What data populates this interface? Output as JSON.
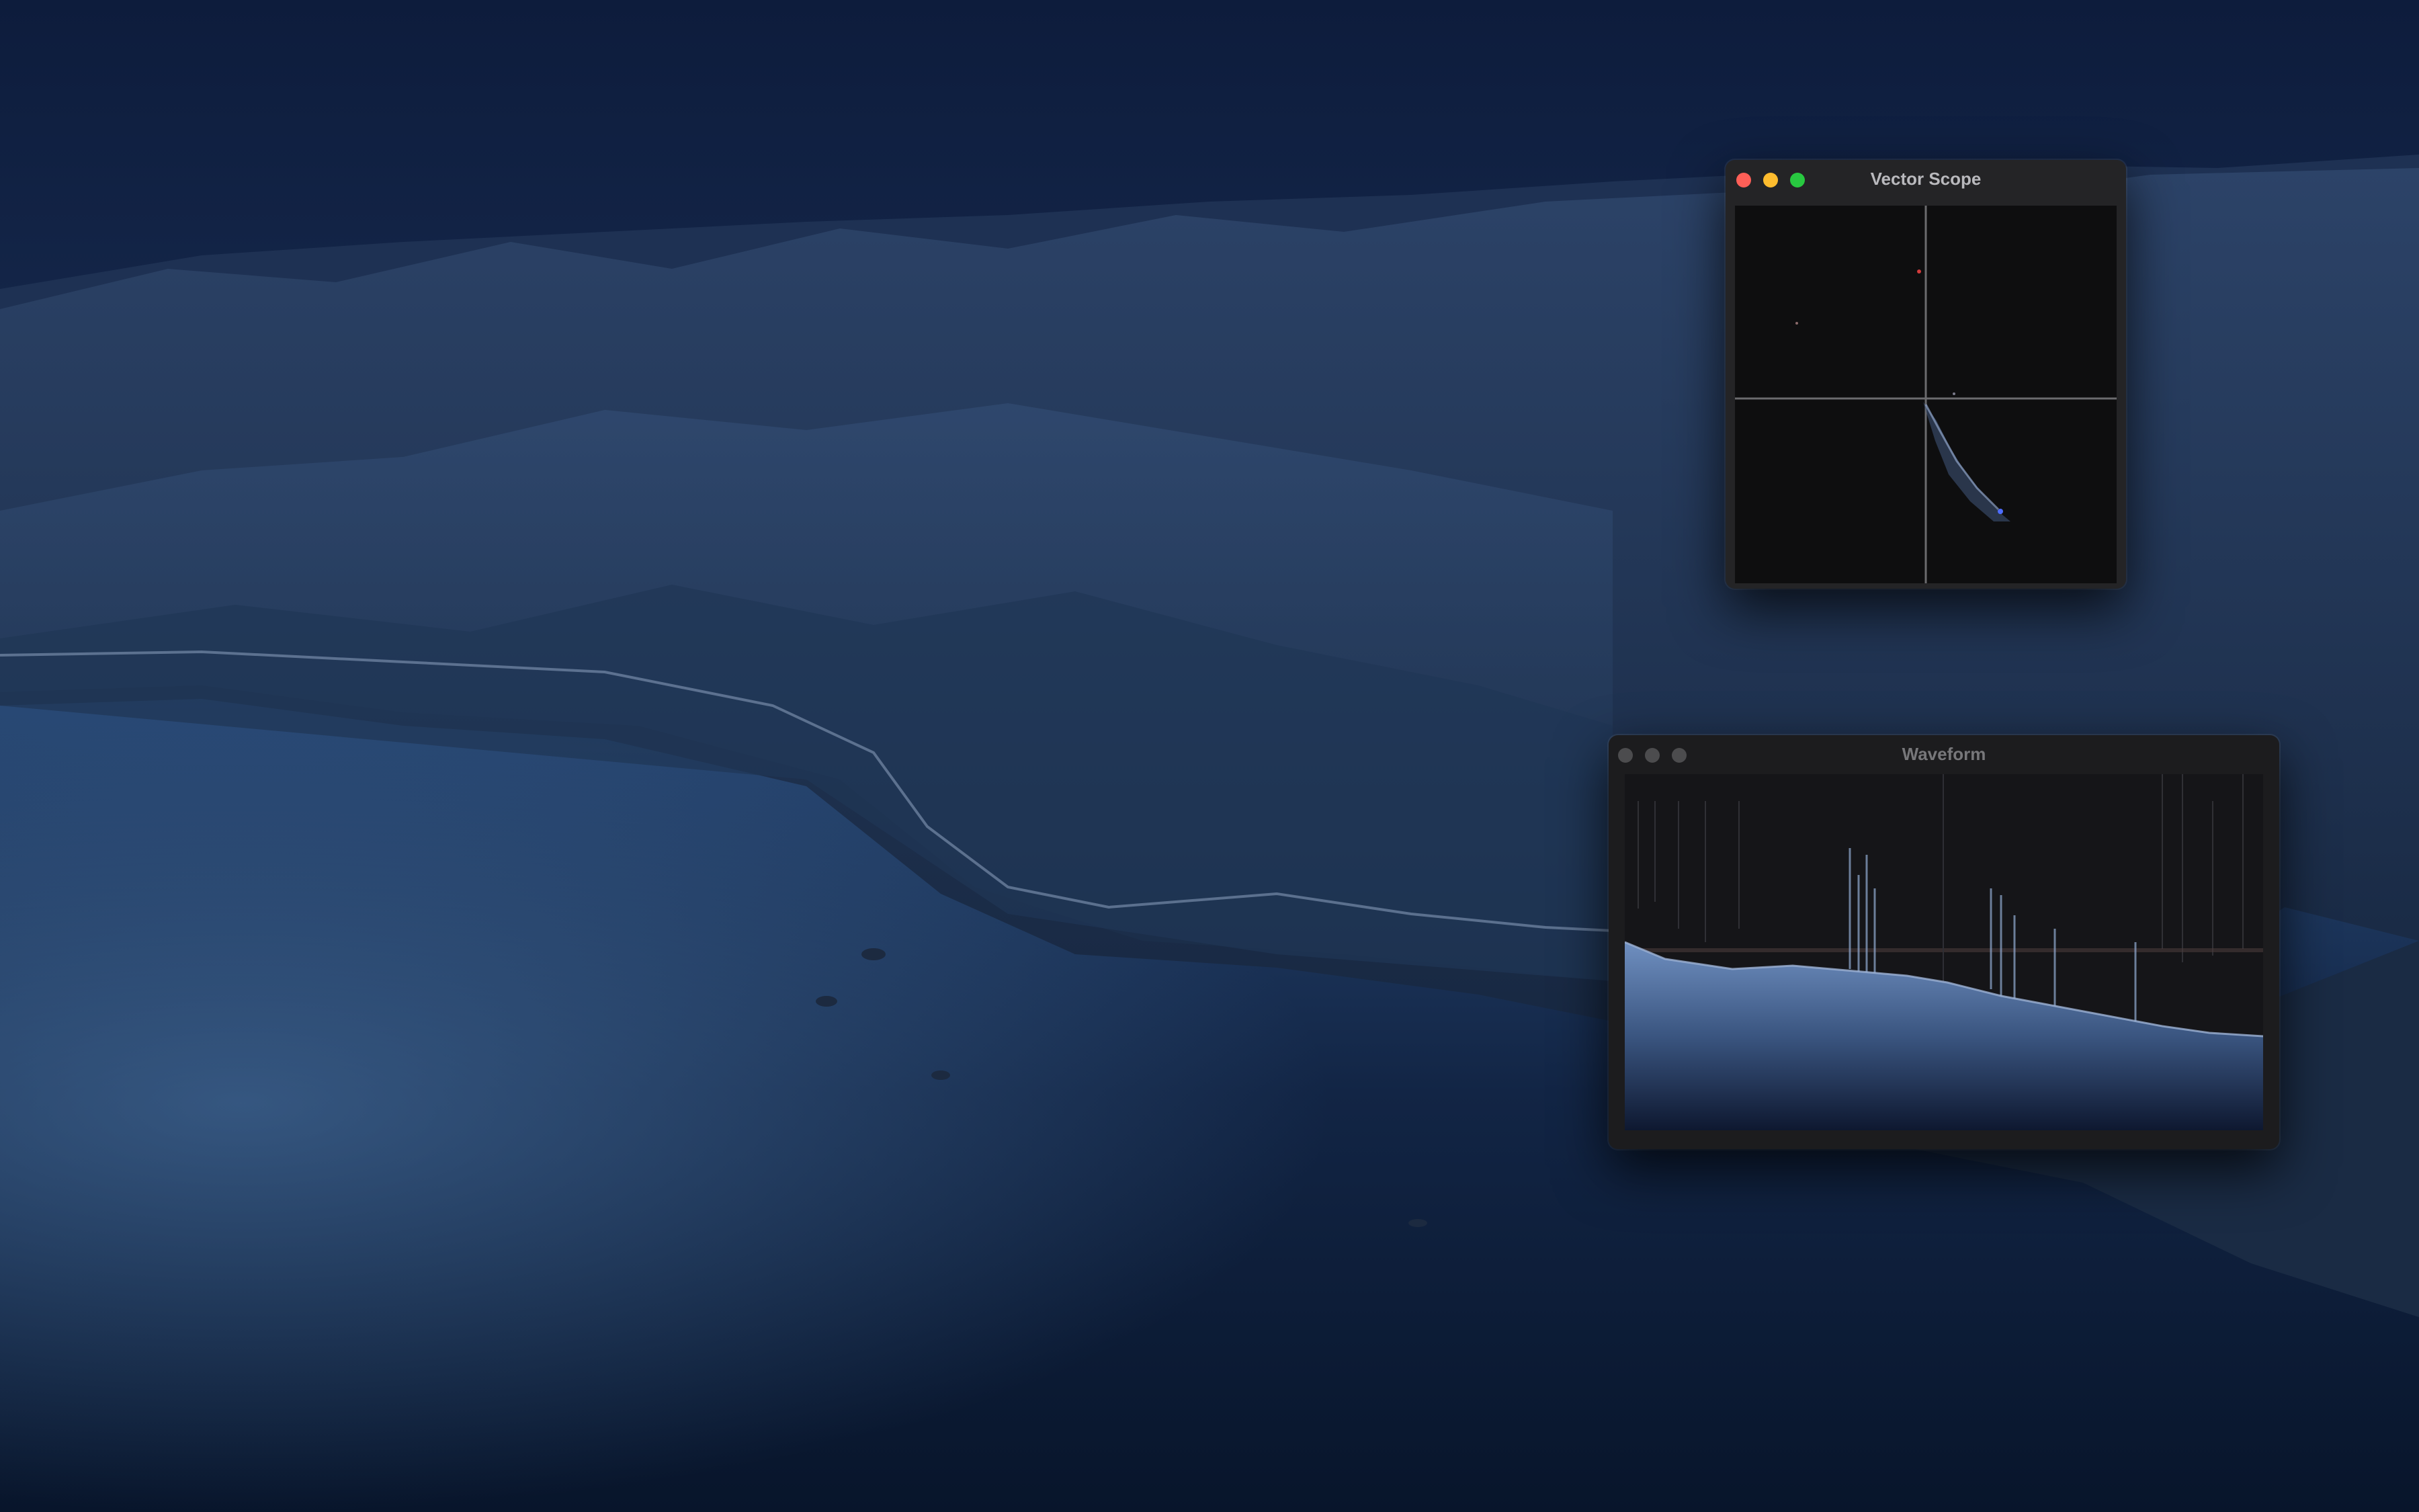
{
  "desktop": {
    "wallpaper": "big-sur-coast-night"
  },
  "windows": {
    "vector_scope": {
      "title": "Vector Scope",
      "traffic_lights": {
        "close": "#fe5f57",
        "minimize": "#febc2e",
        "zoom": "#28c840"
      }
    },
    "waveform": {
      "title": "Waveform",
      "traffic_lights": {
        "inactive": "#4c4c4e"
      }
    }
  }
}
